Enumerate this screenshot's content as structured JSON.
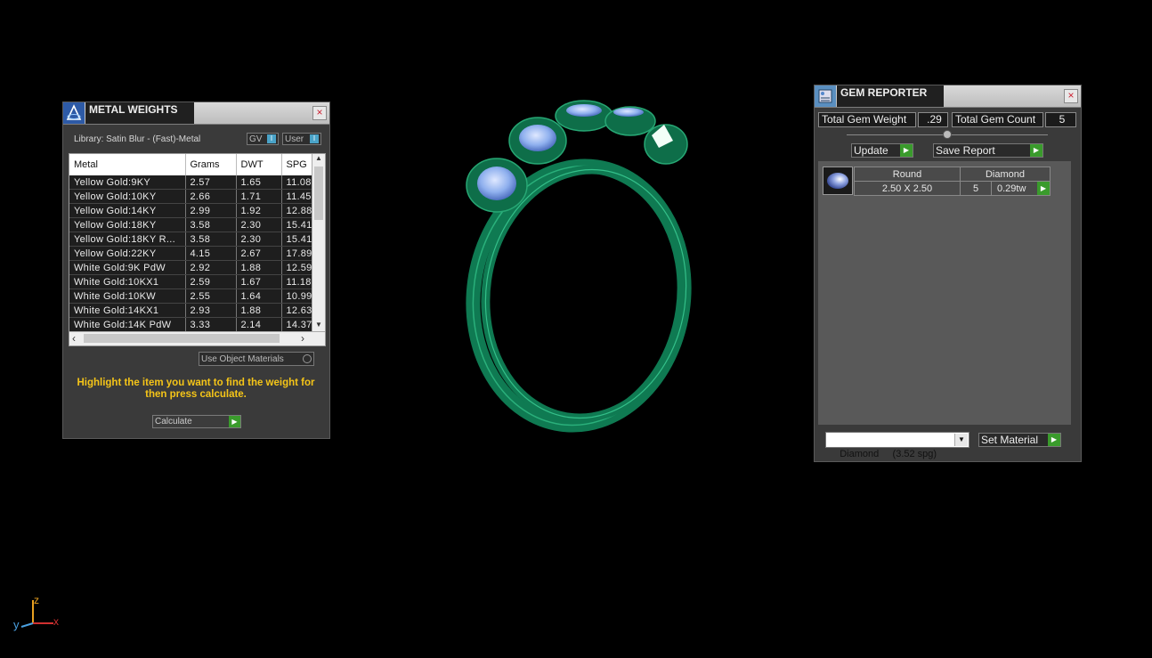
{
  "metal_weights": {
    "title": "METAL WEIGHTS",
    "close": "×",
    "library_label": "Library: Satin Blur - (Fast)-Metal",
    "toggle_gv": "GV",
    "toggle_user": "User",
    "columns": [
      "Metal",
      "Grams",
      "DWT",
      "SPG"
    ],
    "rows": [
      [
        "Yellow Gold:9KY",
        "2.57",
        "1.65",
        "11.08"
      ],
      [
        "Yellow Gold:10KY",
        "2.66",
        "1.71",
        "11.45"
      ],
      [
        "Yellow Gold:14KY",
        "2.99",
        "1.92",
        "12.88"
      ],
      [
        "Yellow Gold:18KY",
        "3.58",
        "2.30",
        "15.41"
      ],
      [
        "Yellow Gold:18KY R...",
        "3.58",
        "2.30",
        "15.41"
      ],
      [
        "Yellow Gold:22KY",
        "4.15",
        "2.67",
        "17.89"
      ],
      [
        "White Gold:9K PdW",
        "2.92",
        "1.88",
        "12.59"
      ],
      [
        "White Gold:10KX1",
        "2.59",
        "1.67",
        "11.18"
      ],
      [
        "White Gold:10KW",
        "2.55",
        "1.64",
        "10.99"
      ],
      [
        "White Gold:14KX1",
        "2.93",
        "1.88",
        "12.63"
      ],
      [
        "White Gold:14K PdW",
        "3.33",
        "2.14",
        "14.37"
      ]
    ],
    "use_object_materials": "Use Object Materials",
    "instruction": "Highlight the item you want to find the weight for then press calculate.",
    "calculate_label": "Calculate"
  },
  "gem_reporter": {
    "title": "GEM REPORTER",
    "close": "×",
    "total_gem_weight_label": "Total Gem Weight",
    "total_gem_weight_value": ".29",
    "total_gem_count_label": "Total Gem Count",
    "total_gem_count_value": "5",
    "update_label": "Update",
    "save_report_label": "Save Report",
    "gem": {
      "shape": "Round",
      "material": "Diamond",
      "size": "2.50 X 2.50",
      "count": "5",
      "weight": "0.29tw"
    },
    "material_select": "Diamond     (3.52 spg)",
    "set_material_label": "Set Material"
  },
  "axis": {
    "z": "z",
    "y": "y",
    "x": "x"
  },
  "colors": {
    "ring": "#0f7a52",
    "gem": "#8fb0ee",
    "accent_green": "#3a9b2c"
  }
}
